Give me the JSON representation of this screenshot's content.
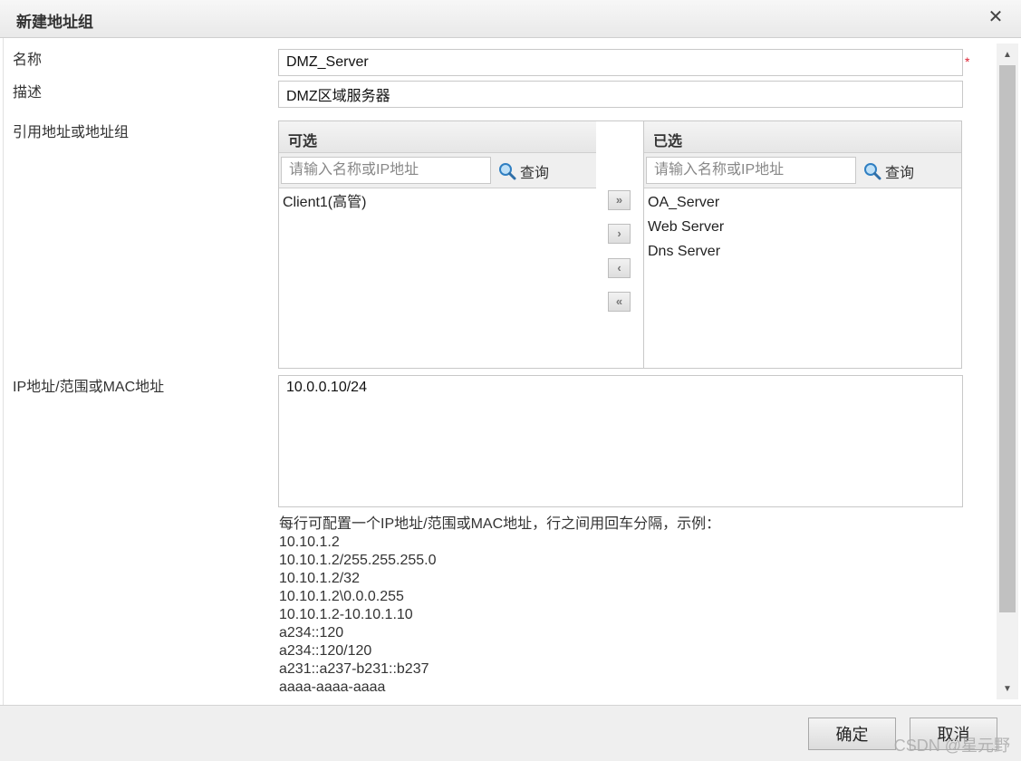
{
  "window": {
    "title": "新建地址组"
  },
  "form": {
    "name_label": "名称",
    "name_value": "DMZ_Server",
    "required_mark": "*",
    "desc_label": "描述",
    "desc_value": "DMZ区域服务器",
    "ref_label": "引用地址或地址组",
    "ip_label": "IP地址/范围或MAC地址",
    "ip_value": "10.0.0.10/24"
  },
  "available": {
    "header": "可选",
    "search_placeholder": "请输入名称或IP地址",
    "search_label": "查询",
    "items": [
      "Client1(高管)"
    ]
  },
  "selected": {
    "header": "已选",
    "search_placeholder": "请输入名称或IP地址",
    "search_label": "查询",
    "items": [
      "OA_Server",
      "Web Server",
      "Dns Server"
    ]
  },
  "transfer": {
    "add_all": "»",
    "add": "›",
    "remove": "‹",
    "remove_all": "«"
  },
  "help": {
    "lines": [
      "每行可配置一个IP地址/范围或MAC地址，行之间用回车分隔，示例：",
      "10.10.1.2",
      "10.10.1.2/255.255.255.0",
      "10.10.1.2/32",
      "10.10.1.2\\0.0.0.255",
      "10.10.1.2-10.10.1.10",
      "a234::120",
      "a234::120/120",
      "a231::a237-b231::b237",
      "aaaa-aaaa-aaaa"
    ]
  },
  "footer": {
    "ok_label": "确定",
    "cancel_label": "取消",
    "watermark": "CSDN @星元野"
  },
  "icons": {
    "close": "close-icon",
    "search": "search-icon"
  }
}
